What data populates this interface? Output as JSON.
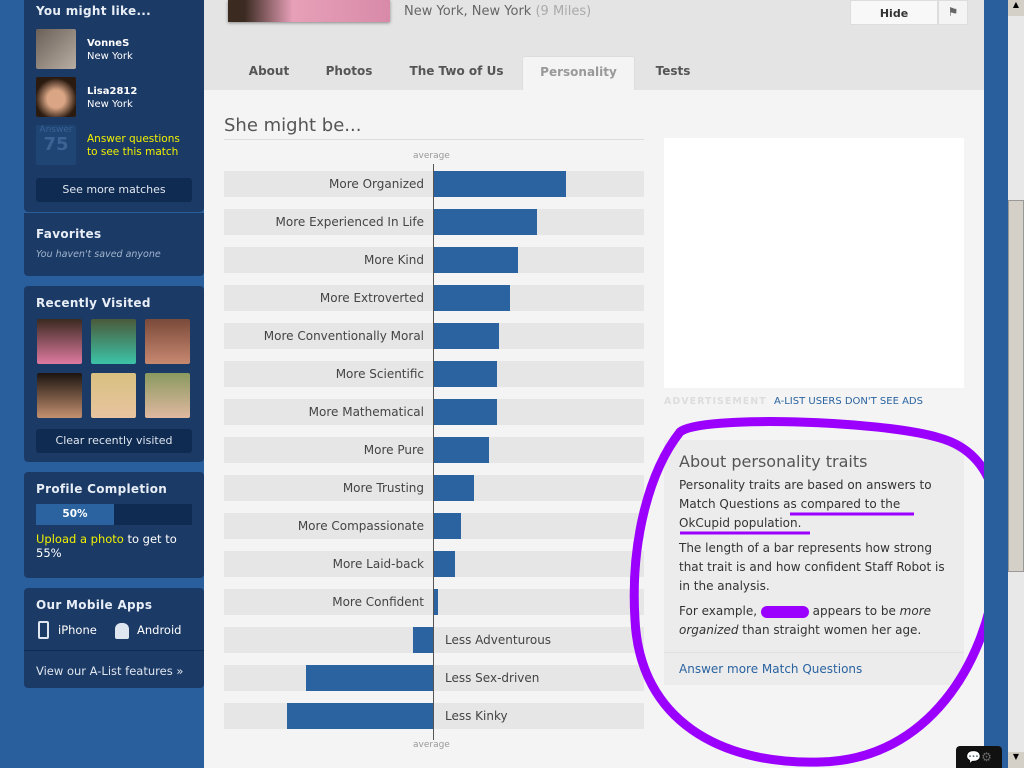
{
  "sidebar": {
    "you_might_like": {
      "title": "You might like...",
      "matches": [
        {
          "name": "VonneS",
          "location": "New York"
        },
        {
          "name": "Lisa2812",
          "location": "New York"
        }
      ],
      "locked": {
        "badge_label": "Answer",
        "badge_count": "75",
        "text1": "Answer questions",
        "text2": "to see this match"
      },
      "see_more": "See more matches"
    },
    "favorites": {
      "title": "Favorites",
      "empty": "You haven't saved anyone"
    },
    "recently_visited": {
      "title": "Recently Visited",
      "clear": "Clear recently visited"
    },
    "profile_completion": {
      "title": "Profile Completion",
      "percent": 50,
      "percent_label": "50%",
      "link": "Upload a photo",
      "rest": " to get to 55%"
    },
    "mobile": {
      "title": "Our Mobile Apps",
      "iphone": "iPhone",
      "android": "Android",
      "alist": "View our A-List features »"
    }
  },
  "profile": {
    "location": "New York, New York",
    "distance": "(9 Miles)",
    "hide": "Hide"
  },
  "tabs": [
    {
      "label": "About"
    },
    {
      "label": "Photos"
    },
    {
      "label": "The Two of Us"
    },
    {
      "label": "Personality",
      "active": true
    },
    {
      "label": "Tests"
    }
  ],
  "section_title": "She might be...",
  "chart_data": {
    "type": "bar",
    "orientation": "horizontal",
    "center_label": "average",
    "scale": "relative to average (-1 to 1)",
    "categories": [
      "More Organized",
      "More Experienced In Life",
      "More Kind",
      "More Extroverted",
      "More Conventionally Moral",
      "More Scientific",
      "More Mathematical",
      "More Pure",
      "More Trusting",
      "More Compassionate",
      "More Laid-back",
      "More Confident",
      "Less Adventurous",
      "Less Sex-driven",
      "Less Kinky"
    ],
    "values": [
      0.63,
      0.49,
      0.4,
      0.36,
      0.31,
      0.3,
      0.3,
      0.26,
      0.19,
      0.13,
      0.1,
      0.02,
      -0.1,
      -0.61,
      -0.7
    ],
    "bar_color": "#2a63a0"
  },
  "ad": {
    "label": "ADVERTISEMENT",
    "alist": "A-LIST USERS DON'T SEE ADS"
  },
  "about": {
    "title": "About personality traits",
    "p1a": "Personality traits are based on answers to Match Questions ",
    "p1b": "as compared to the OkCupid population.",
    "p2": "The length of a bar represents how strong that trait is and how confident Staff Robot is in the analysis.",
    "p3a": "For example, ",
    "p3b": " appears to be ",
    "p3c": "more organized",
    "p3d": " than straight women her age.",
    "link": "Answer more Match Questions"
  },
  "annotation_color": "#9b00ff"
}
